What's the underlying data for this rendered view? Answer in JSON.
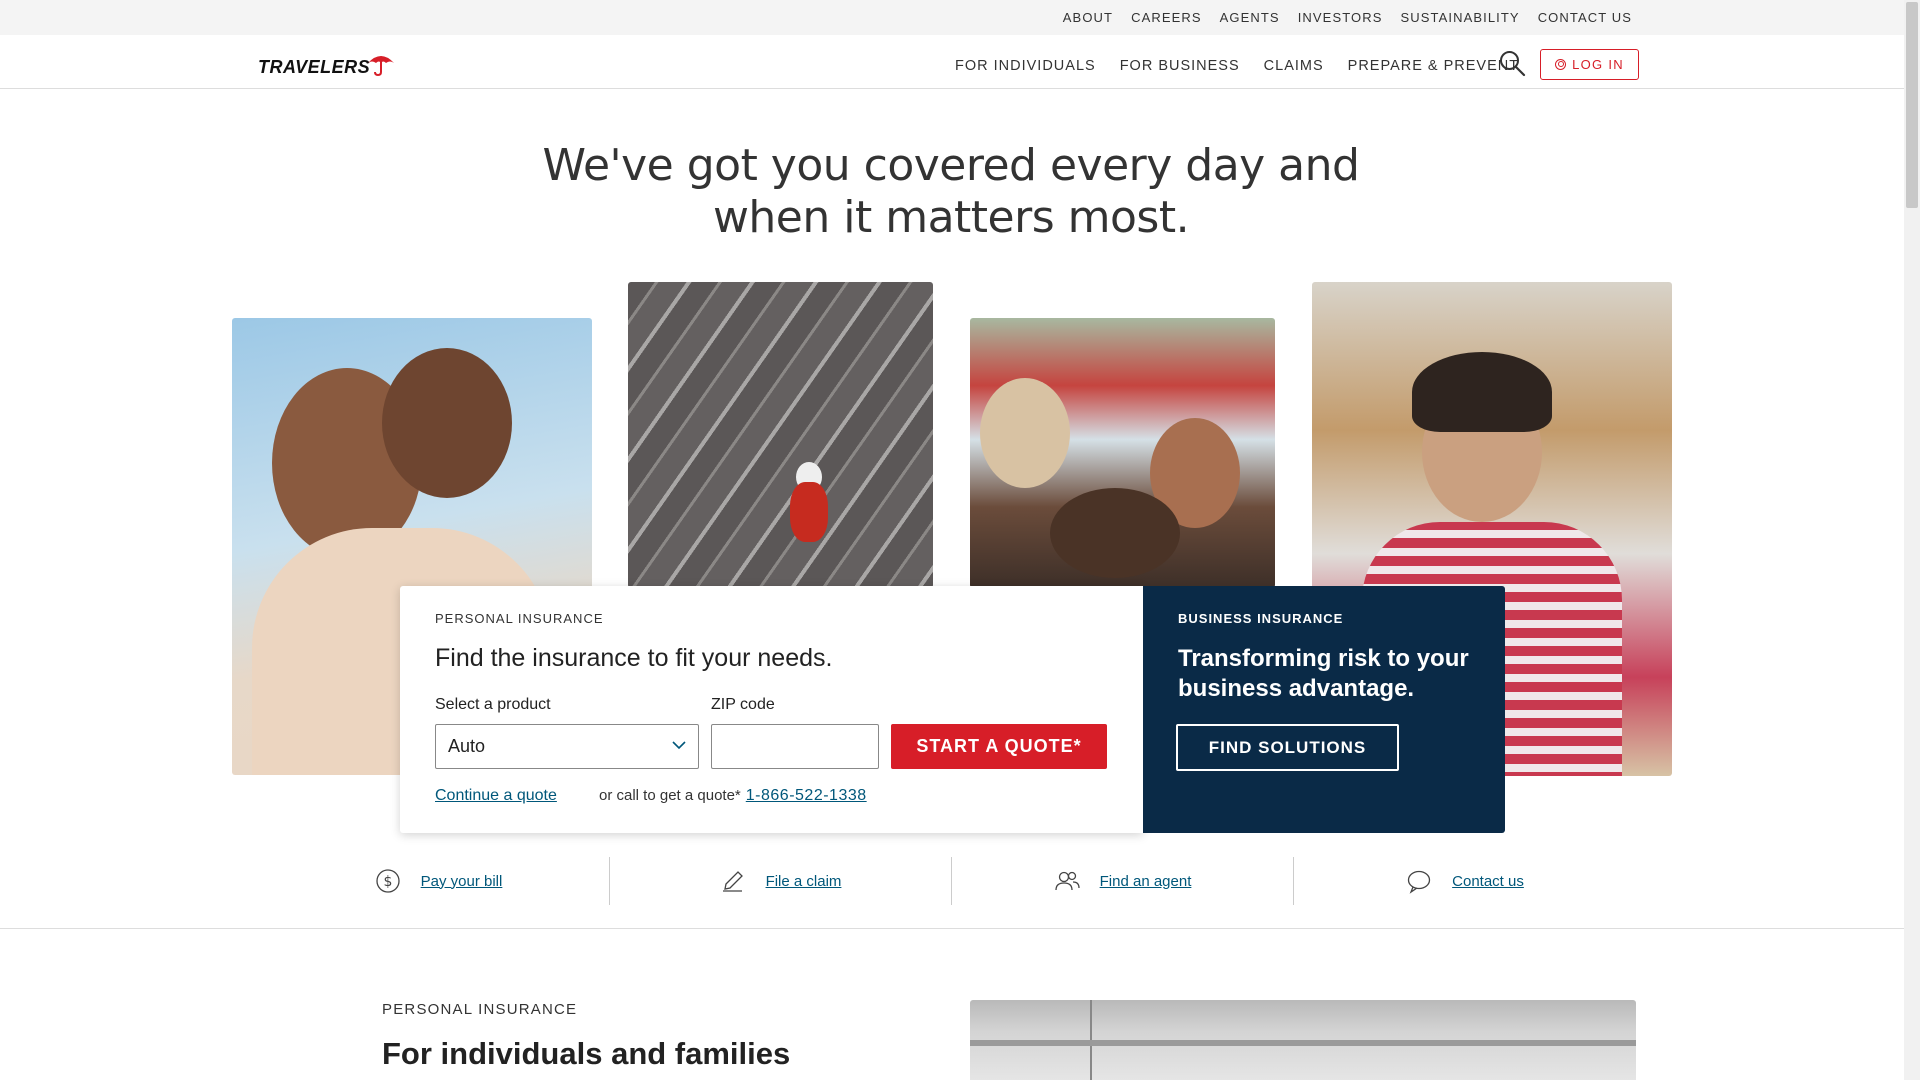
{
  "utility_nav": [
    "ABOUT",
    "CAREERS",
    "AGENTS",
    "INVESTORS",
    "SUSTAINABILITY",
    "CONTACT US"
  ],
  "logo": {
    "text": "TRAVELERS",
    "icon": "umbrella-icon",
    "brand_color": "#d71e28"
  },
  "main_nav": [
    "FOR INDIVIDUALS",
    "FOR BUSINESS",
    "CLAIMS",
    "PREPARE & PREVENT"
  ],
  "login_label": "LOG IN",
  "hero": {
    "title": "We've got you covered every day and when it matters most."
  },
  "quote": {
    "eyebrow": "PERSONAL INSURANCE",
    "title": "Find the insurance to fit your needs.",
    "product_label": "Select a product",
    "product_value": "Auto",
    "zip_label": "ZIP code",
    "zip_value": "",
    "start_label": "START A QUOTE*",
    "continue_label": "Continue a quote",
    "call_text": "or call to get a quote*",
    "phone": "1-866-522-1338"
  },
  "business": {
    "eyebrow": "BUSINESS INSURANCE",
    "title": "Transforming risk to your business advantage.",
    "button_label": "FIND SOLUTIONS",
    "background": "#0a2a47"
  },
  "quick_links": [
    {
      "label": "Pay your bill",
      "icon": "dollar-icon"
    },
    {
      "label": "File a claim",
      "icon": "pencil-icon"
    },
    {
      "label": "Find an agent",
      "icon": "people-icon"
    },
    {
      "label": "Contact us",
      "icon": "chat-icon"
    }
  ],
  "section": {
    "eyebrow": "PERSONAL INSURANCE",
    "title": "For individuals and families"
  },
  "colors": {
    "link": "#00577a",
    "accent": "#d71e28",
    "navy": "#0a2a47"
  }
}
